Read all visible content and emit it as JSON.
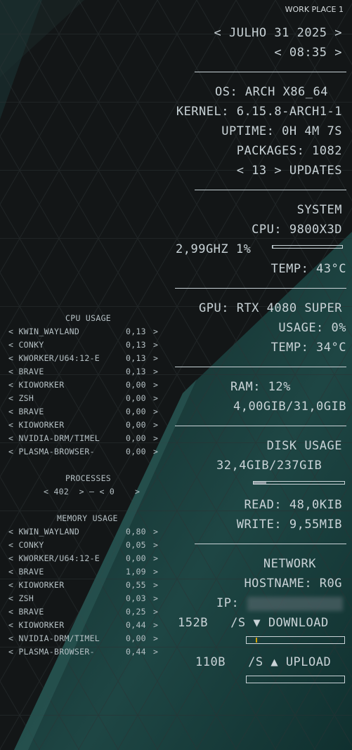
{
  "workspace": "WORK PLACE 1",
  "date_line": "< JULHO 31 2025 >",
  "time_line": "< 08:35 >",
  "os_line": "OS: ARCH X86_64",
  "kernel_line": "KERNEL: 6.15.8-ARCH1-1",
  "uptime_line": "UPTIME: 0H 4M 7S",
  "packages_line": "PACKAGES: 1082",
  "updates_line": "< 13 > UPDATES",
  "system_title": "SYSTEM",
  "cpu_line": "CPU: 9800X3D",
  "cpu_freq_line": "2,99GHZ 1%",
  "cpu_usage_fraction": 0.01,
  "cpu_temp_line": "TEMP: 43°C",
  "gpu_line": "GPU: RTX 4080 SUPER",
  "gpu_usage_line": "USAGE: 0%",
  "gpu_temp_line": "TEMP: 34°C",
  "ram_line": "RAM: 12%",
  "ram_amount_line": "4,00GIB/31,0GIB",
  "disk_title": "DISK USAGE",
  "disk_amount_line": "32,4GIB/237GIB",
  "disk_usage_fraction": 0.137,
  "read_line": "READ: 48,0KIB",
  "write_line": "WRITE: 9,55MIB",
  "network_title": "NETWORK",
  "hostname_line": "HOSTNAME: R0G",
  "ip_label": "IP:",
  "download_line": "152B   /S ▼ DOWNLOAD",
  "upload_line": "110B   /S ▲ UPLOAD",
  "cpu_usage_title": "CPU USAGE",
  "cpu_processes": [
    {
      "name": "< KWIN_WAYLAND",
      "value": "0,13",
      "end": ">"
    },
    {
      "name": "< CONKY",
      "value": "0,13",
      "end": ">"
    },
    {
      "name": "< KWORKER/U64:12-E",
      "value": "0,13",
      "end": ">"
    },
    {
      "name": "< BRAVE",
      "value": "0,13",
      "end": ">"
    },
    {
      "name": "< KIOWORKER",
      "value": "0,00",
      "end": ">"
    },
    {
      "name": "< ZSH",
      "value": "0,00",
      "end": ">"
    },
    {
      "name": "< BRAVE",
      "value": "0,00",
      "end": ">"
    },
    {
      "name": "< KIOWORKER",
      "value": "0,00",
      "end": ">"
    },
    {
      "name": "< NVIDIA-DRM/TIMEL",
      "value": "0,00",
      "end": ">"
    },
    {
      "name": "< PLASMA-BROWSER-",
      "value": "0,00",
      "end": ">"
    }
  ],
  "processes_title": "PROCESSES",
  "processes_line": "< 402  > — < 0    >",
  "memory_usage_title": "MEMORY USAGE",
  "mem_processes": [
    {
      "name": "< KWIN_WAYLAND",
      "value": "0,80",
      "end": ">"
    },
    {
      "name": "< CONKY",
      "value": "0,05",
      "end": ">"
    },
    {
      "name": "< KWORKER/U64:12-E",
      "value": "0,00",
      "end": ">"
    },
    {
      "name": "< BRAVE",
      "value": "1,09",
      "end": ">"
    },
    {
      "name": "< KIOWORKER",
      "value": "0,55",
      "end": ">"
    },
    {
      "name": "< ZSH",
      "value": "0,03",
      "end": ">"
    },
    {
      "name": "< BRAVE",
      "value": "0,25",
      "end": ">"
    },
    {
      "name": "< KIOWORKER",
      "value": "0,44",
      "end": ">"
    },
    {
      "name": "< NVIDIA-DRM/TIMEL",
      "value": "0,00",
      "end": ">"
    },
    {
      "name": "< PLASMA-BROWSER-",
      "value": "0,44",
      "end": ">"
    }
  ],
  "colors": {
    "text": "#c9d3d7",
    "background": "#121516",
    "accent_teal": "#1f4a49",
    "download_tick": "#d9a500"
  }
}
